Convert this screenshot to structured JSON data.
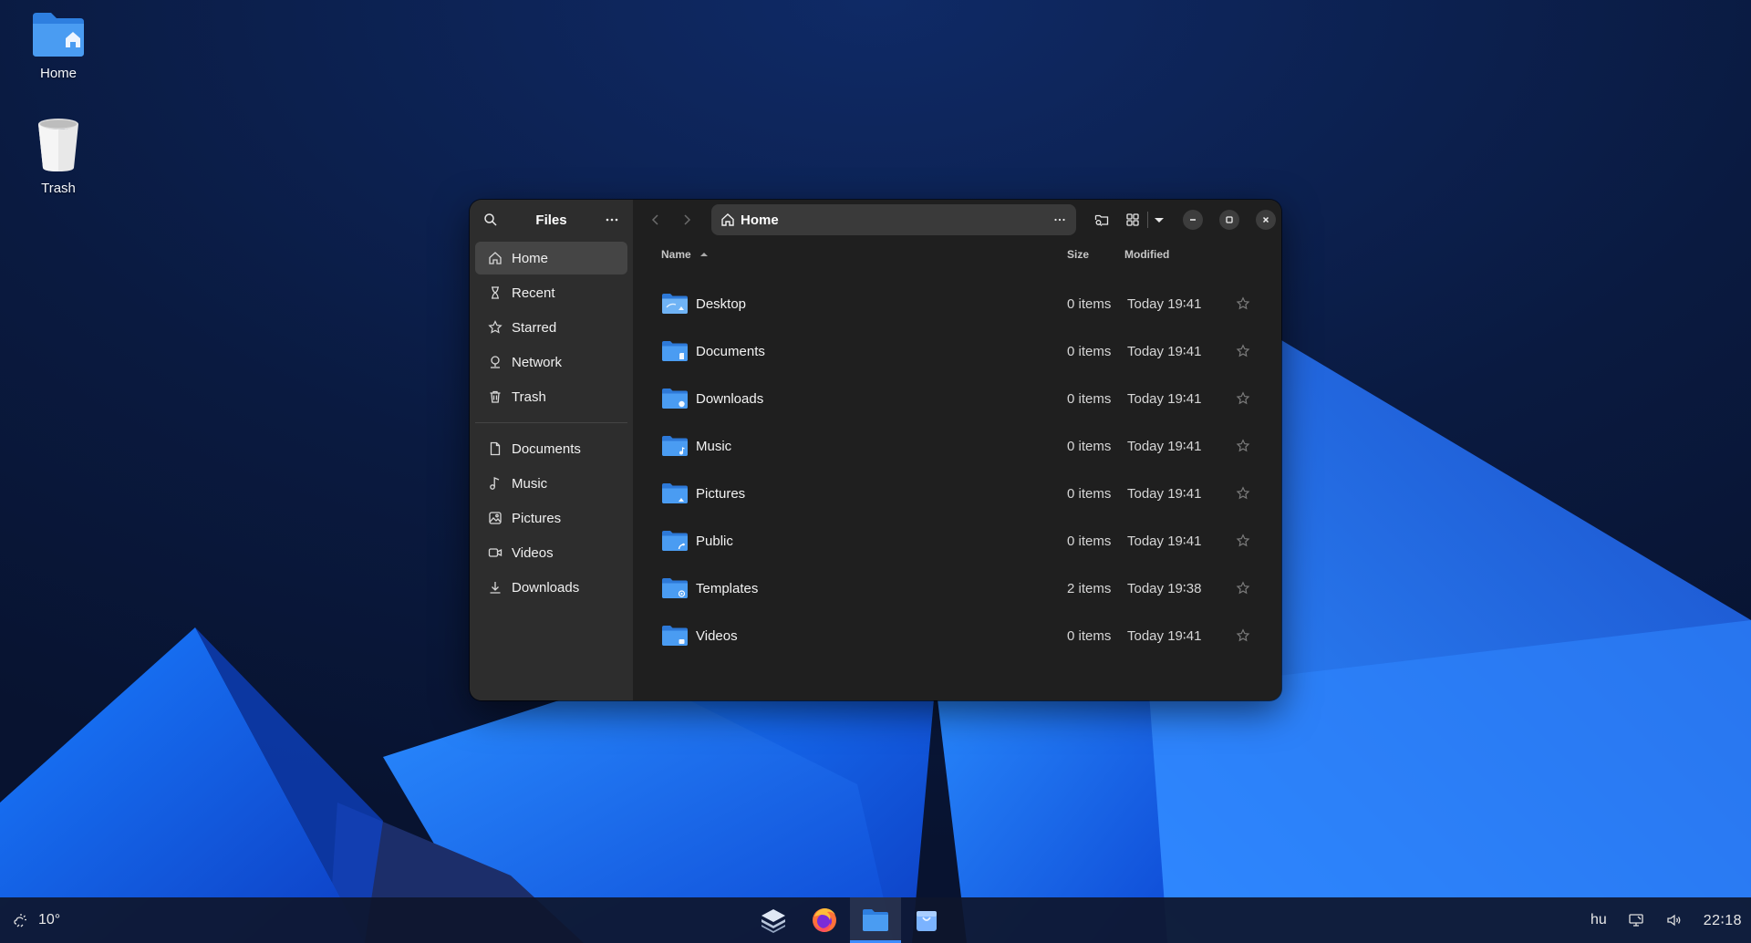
{
  "desktop": {
    "icons": [
      {
        "label": "Home",
        "icon": "home-folder-icon"
      },
      {
        "label": "Trash",
        "icon": "trash-bin-icon"
      }
    ]
  },
  "window": {
    "sidebar": {
      "title": "Files",
      "places": [
        {
          "label": "Home",
          "icon": "home-icon",
          "active": true
        },
        {
          "label": "Recent",
          "icon": "clock-icon"
        },
        {
          "label": "Starred",
          "icon": "star-icon"
        },
        {
          "label": "Network",
          "icon": "network-icon"
        },
        {
          "label": "Trash",
          "icon": "trash-icon"
        }
      ],
      "bookmarks": [
        {
          "label": "Documents",
          "icon": "document-icon"
        },
        {
          "label": "Music",
          "icon": "music-icon"
        },
        {
          "label": "Pictures",
          "icon": "picture-icon"
        },
        {
          "label": "Videos",
          "icon": "video-icon"
        },
        {
          "label": "Downloads",
          "icon": "download-icon"
        }
      ]
    },
    "path": {
      "current": "Home"
    },
    "columns": {
      "name": "Name",
      "size": "Size",
      "modified": "Modified"
    },
    "files": [
      {
        "name": "Desktop",
        "size": "0 items",
        "modified": "Today 19∶41",
        "icon": "desktop-folder-icon"
      },
      {
        "name": "Documents",
        "size": "0 items",
        "modified": "Today 19∶41",
        "icon": "documents-folder-icon"
      },
      {
        "name": "Downloads",
        "size": "0 items",
        "modified": "Today 19∶41",
        "icon": "downloads-folder-icon"
      },
      {
        "name": "Music",
        "size": "0 items",
        "modified": "Today 19∶41",
        "icon": "music-folder-icon"
      },
      {
        "name": "Pictures",
        "size": "0 items",
        "modified": "Today 19∶41",
        "icon": "pictures-folder-icon"
      },
      {
        "name": "Public",
        "size": "0 items",
        "modified": "Today 19∶41",
        "icon": "public-folder-icon"
      },
      {
        "name": "Templates",
        "size": "2 items",
        "modified": "Today 19∶38",
        "icon": "templates-folder-icon"
      },
      {
        "name": "Videos",
        "size": "0 items",
        "modified": "Today 19∶41",
        "icon": "videos-folder-icon"
      }
    ]
  },
  "taskbar": {
    "weather": "10°",
    "apps": [
      {
        "name": "stack-app-icon",
        "active": false
      },
      {
        "name": "firefox-icon",
        "active": false
      },
      {
        "name": "files-app-icon",
        "active": true
      },
      {
        "name": "software-store-icon",
        "active": false
      }
    ],
    "keyboard_layout": "hu",
    "clock": "22∶18"
  },
  "colors": {
    "accent": "#3b8cff",
    "folder": "#3d8fe6",
    "window_bg": "#1f1f1f",
    "sidebar_bg": "#2d2d2d"
  }
}
